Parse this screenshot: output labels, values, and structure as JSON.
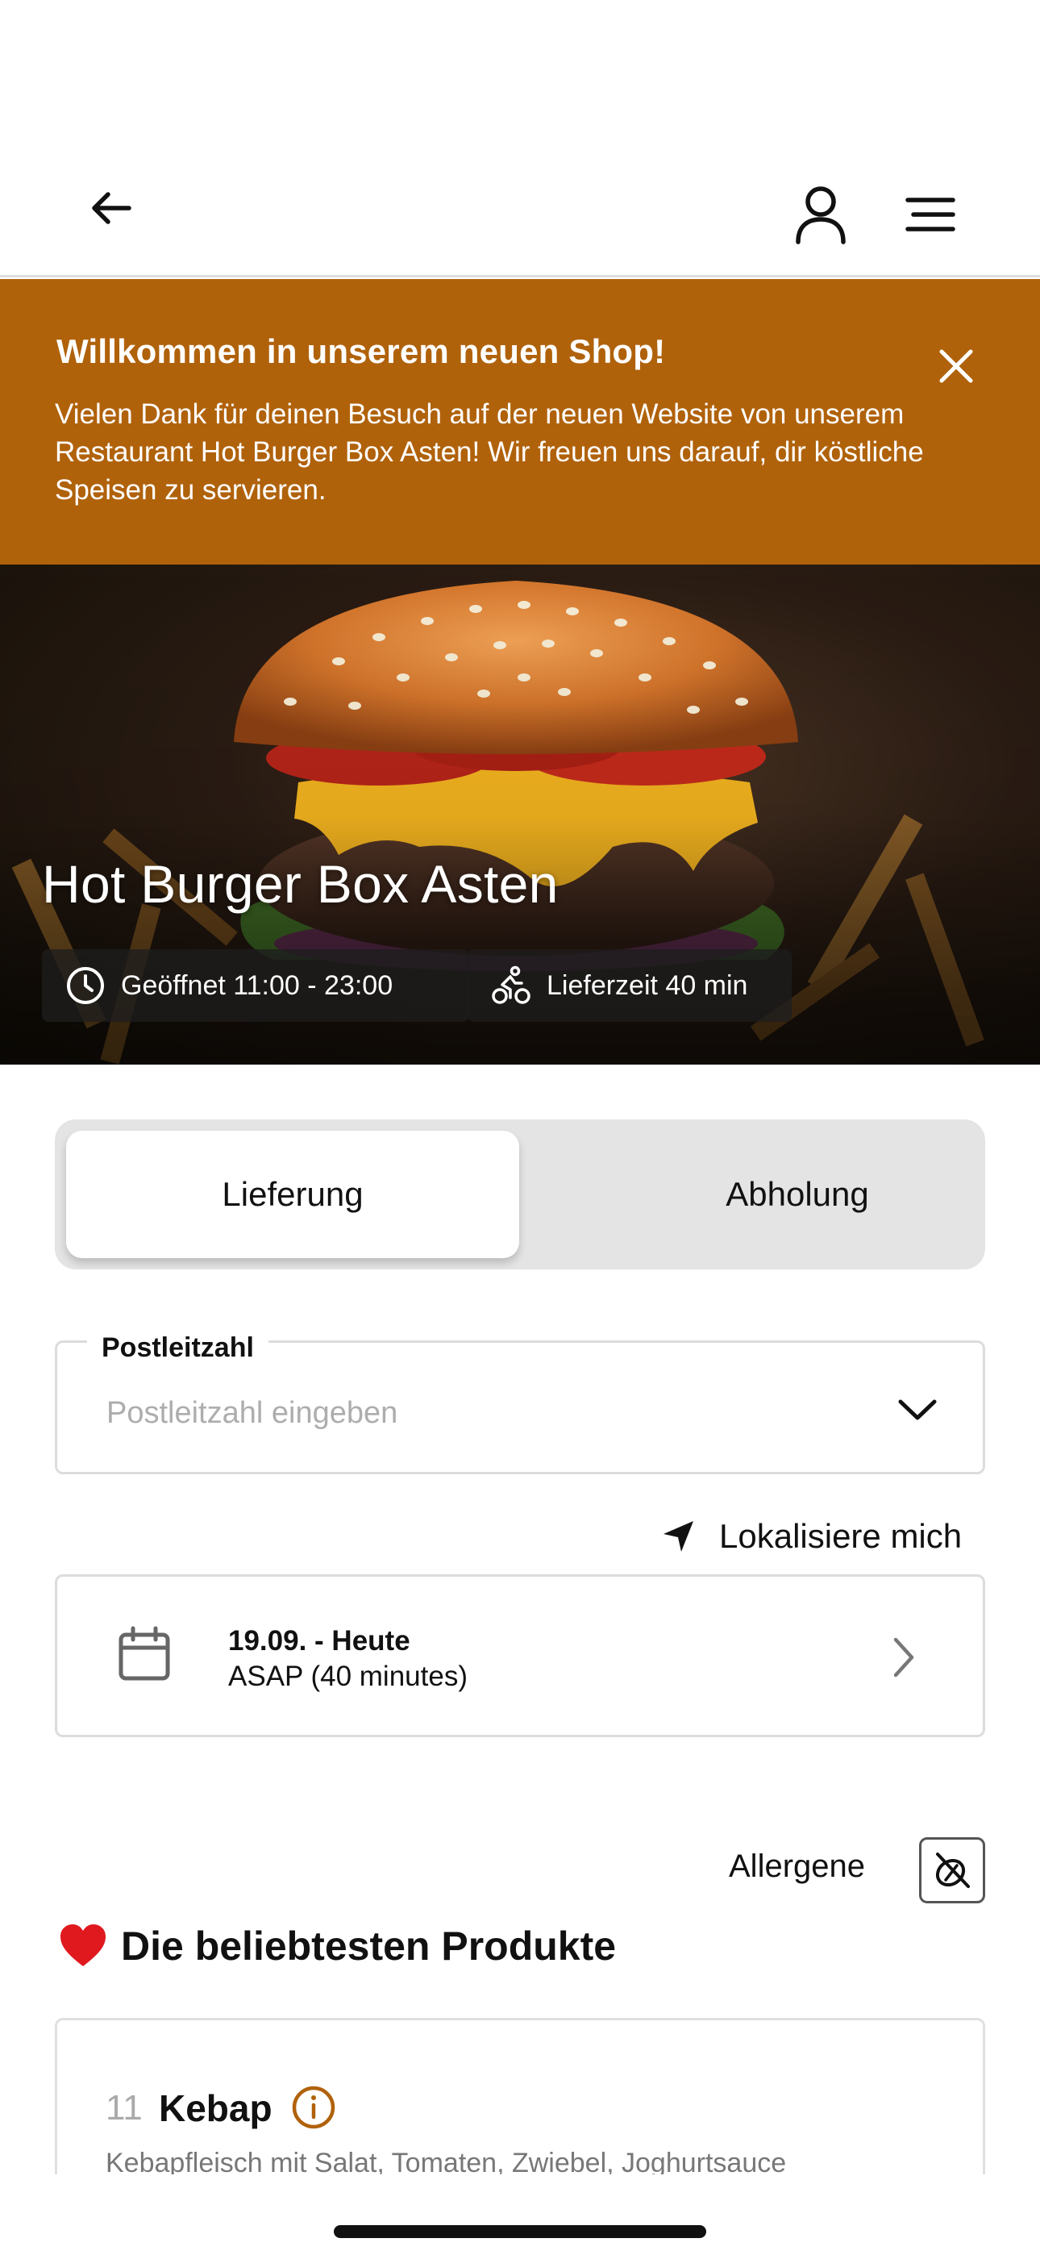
{
  "header": {
    "back_icon": "arrow-left-icon",
    "user_icon": "user-icon",
    "menu_icon": "menu-icon"
  },
  "banner": {
    "title": "Willkommen in unserem neuen Shop!",
    "text": "Vielen Dank für deinen Besuch auf der neuen Website von unserem Restaurant Hot Burger Box Asten! Wir freuen uns darauf, dir köstliche Speisen zu servieren.",
    "background": "#b0620b",
    "close_icon": "close-icon"
  },
  "hero": {
    "restaurant_name": "Hot Burger Box Asten",
    "opening_hours": "Geöffnet 11:00 - 23:00",
    "delivery_time": "Lieferzeit 40 min",
    "clock_icon": "clock-icon",
    "bike_icon": "cyclist-icon"
  },
  "order_mode": {
    "delivery_label": "Lieferung",
    "pickup_label": "Abholung",
    "selected": "Lieferung"
  },
  "zip": {
    "label": "Postleitzahl",
    "placeholder": "Postleitzahl eingeben",
    "value": ""
  },
  "locate": {
    "label": "Lokalisiere mich",
    "icon": "location-arrow-icon"
  },
  "date_picker": {
    "date_label": "19.09. - Heute",
    "time_label": "ASAP (40 minutes)",
    "icon": "calendar-icon"
  },
  "allergens": {
    "label": "Allergene",
    "icon": "allergen-icon"
  },
  "popular": {
    "title": "Die beliebtesten Produkte",
    "icon": "heart-icon"
  },
  "products": [
    {
      "number": "11",
      "name": "Kebap",
      "description": "Kebapfleisch mit Salat, Tomaten, Zwiebel, Joghurtsauce"
    }
  ],
  "colors": {
    "accent": "#b0620b",
    "info_icon": "#b0620b"
  }
}
